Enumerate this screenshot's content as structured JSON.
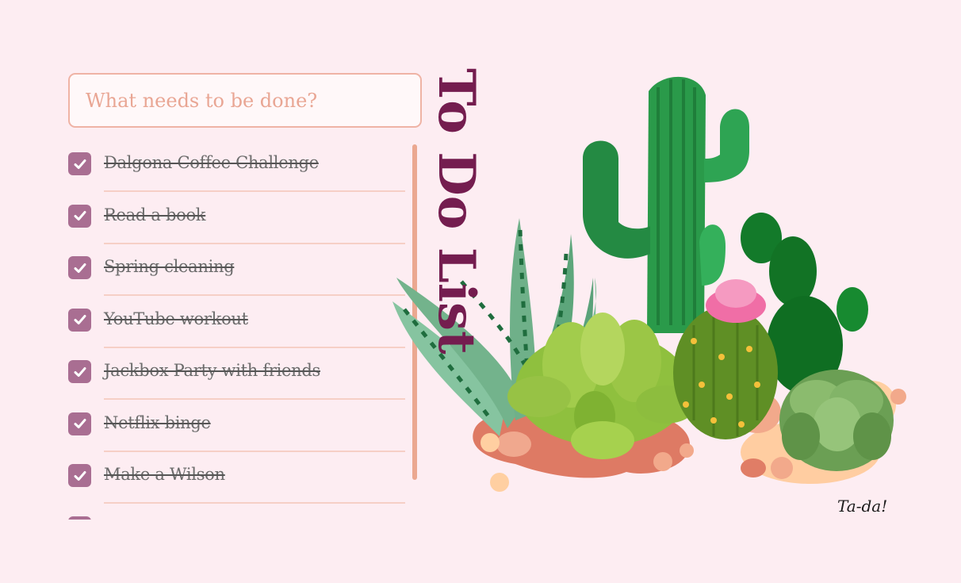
{
  "input": {
    "placeholder": "What needs to be done?"
  },
  "title": "To Do List",
  "todos": [
    {
      "label": "Dalgona Coffee Challenge",
      "completed": true
    },
    {
      "label": "Read a book",
      "completed": true
    },
    {
      "label": "Spring cleaning",
      "completed": true
    },
    {
      "label": "YouTube workout",
      "completed": true
    },
    {
      "label": "Jackbox Party with friends",
      "completed": true
    },
    {
      "label": "Netflix binge",
      "completed": true
    },
    {
      "label": "Make a Wilson",
      "completed": true
    },
    {
      "label": "",
      "completed": true
    }
  ],
  "footer": {
    "text": "Ta-da!"
  },
  "colors": {
    "background": "#fdedf2",
    "accent": "#a96e92",
    "title": "#741d4f",
    "input_border": "#efb3a5",
    "divider": "#f6cfc6",
    "scrollbar": "#eba891"
  },
  "icons": {
    "checkbox": "check-icon",
    "illustration": "cactus-illustration"
  }
}
